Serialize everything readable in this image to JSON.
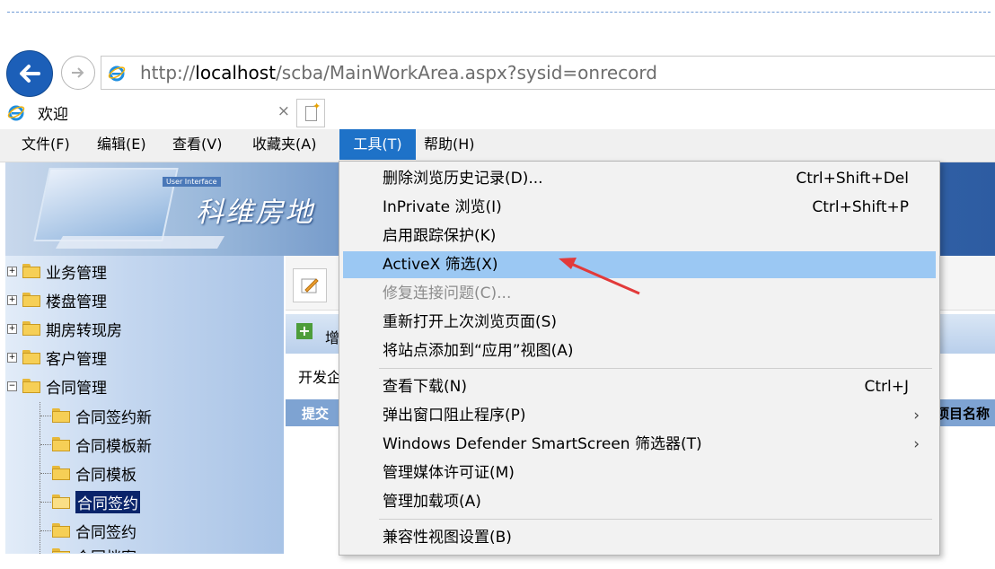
{
  "browser": {
    "address": {
      "prefix": "http://",
      "host": "localhost",
      "path": "/scba/MainWorkArea.aspx?sysid=onrecord"
    },
    "tab": {
      "title": "欢迎",
      "close": "×"
    }
  },
  "menubar": {
    "items": [
      "文件(F)",
      "编辑(E)",
      "查看(V)",
      "收藏夹(A)",
      "工具(T)",
      "帮助(H)"
    ],
    "active": "工具(T)"
  },
  "tools_menu": {
    "items": [
      {
        "label": "删除浏览历史记录(D)...",
        "shortcut": "Ctrl+Shift+Del"
      },
      {
        "label": "InPrivate 浏览(I)",
        "shortcut": "Ctrl+Shift+P"
      },
      {
        "label": "启用跟踪保护(K)",
        "shortcut": ""
      },
      {
        "label": "ActiveX 筛选(X)",
        "shortcut": "",
        "highlighted": true
      },
      {
        "label": "修复连接问题(C)...",
        "shortcut": "",
        "disabled": true
      },
      {
        "label": "重新打开上次浏览页面(S)",
        "shortcut": ""
      },
      {
        "label": "将站点添加到“应用”视图(A)",
        "shortcut": ""
      },
      {
        "label": "查看下载(N)",
        "shortcut": "Ctrl+J"
      },
      {
        "label": "弹出窗口阻止程序(P)",
        "shortcut": "",
        "submenu": "›"
      },
      {
        "label": "Windows Defender SmartScreen 筛选器(T)",
        "shortcut": "",
        "submenu": "›"
      },
      {
        "label": "管理媒体许可证(M)",
        "shortcut": ""
      },
      {
        "label": "管理加载项(A)",
        "shortcut": ""
      },
      {
        "label": "兼容性视图设置(B)",
        "shortcut": ""
      }
    ]
  },
  "page": {
    "banner_title": "科维房地",
    "banner_screen_label": "User Interface",
    "tree": [
      {
        "label": "业务管理",
        "expander": "+"
      },
      {
        "label": "楼盘管理",
        "expander": "+"
      },
      {
        "label": "期房转现房",
        "expander": "+"
      },
      {
        "label": "客户管理",
        "expander": "+"
      },
      {
        "label": "合同管理",
        "expander": "−"
      },
      {
        "label": "合同签约新"
      },
      {
        "label": "合同模板新"
      },
      {
        "label": "合同模板"
      },
      {
        "label": "合同签约",
        "selected": true
      },
      {
        "label": "合同签约"
      },
      {
        "label": "合同档案"
      }
    ],
    "toolbar_add_label": "增",
    "developer_label": "开发企",
    "grid_headers": {
      "submit": "提交",
      "project_name": "项目名称"
    }
  },
  "colors": {
    "accent": "#1e72c8",
    "menu_highlight": "#9bc8f3",
    "arrow": "#e23a3a"
  }
}
